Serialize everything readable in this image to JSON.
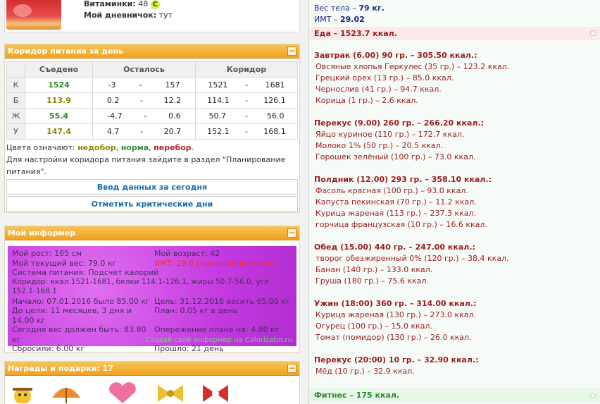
{
  "profile": {
    "vitamins_label": "Витаминки:",
    "vitamins_value": "48",
    "vitamins_badge": "C",
    "diary_label": "Мой дневничок:",
    "diary_value": "тут"
  },
  "corridor": {
    "title": "Коридор питания за день",
    "collapse_glyph": "−",
    "headers": [
      "Съедено",
      "Осталось",
      "Коридор"
    ],
    "dash": "-",
    "rows": [
      {
        "letter": "К",
        "eaten": "1524",
        "rem_min": "-3",
        "rem_max": "157",
        "c_min": "1521",
        "c_max": "1681"
      },
      {
        "letter": "Б",
        "eaten": "113.9",
        "rem_min": "0.2",
        "rem_max": "12.2",
        "c_min": "114.1",
        "c_max": "126.1"
      },
      {
        "letter": "Ж",
        "eaten": "55.4",
        "rem_min": "-4.7",
        "rem_max": "0.6",
        "c_min": "50.7",
        "c_max": "56.0"
      },
      {
        "letter": "У",
        "eaten": "147.4",
        "rem_min": "4.7",
        "rem_max": "20.7",
        "c_min": "152.1",
        "c_max": "168.1"
      }
    ],
    "legend_prefix": "Цвета означают:",
    "legend_under": "недобор",
    "legend_norm": "норма",
    "legend_over": "перебор",
    "legend_end": ".",
    "settings_text": "Для настройки коридора питания зайдите в раздел \"Планирование питания\".",
    "btn_input": "Ввод данных за сегодня",
    "btn_critical": "Отметить критические дни",
    "colors": {
      "under": "#8a8a00",
      "norm": "#2e8b2e",
      "over": "#b22222"
    }
  },
  "informer": {
    "title": "Мой информер",
    "collapse_glyph": "−",
    "rows": [
      [
        "Мой рост: 165 см",
        "Мой возраст: 42"
      ],
      [
        "Мой текущий вес: 79.0 кг",
        "ИМТ: 29.0 (превышение веса)"
      ],
      [
        "Система питания: Подсчет калорий",
        ""
      ],
      [
        "Коридор: ккал 1521-1681, белки 114.1-126.1, жиры 50.7-56.0, угл 152.1-168.1",
        ""
      ],
      [
        "Начало: 07.01.2016 было 85.00 кг",
        "Цель: 31.12.2016 весить 65.00 кг"
      ],
      [
        "До цели: 11 месяцев, 3 дня и 14.00 кг",
        "План: 0.05 кг в день"
      ],
      [
        "Сегодня вес должен быть: 83.80 кг",
        "Опережение плана на: 4.80 кг"
      ],
      [
        "Сбросили: 6.00 кг",
        "Прошло: 21 день"
      ]
    ],
    "link": "Создай свой информер на Calorizator.ru"
  },
  "gifts": {
    "title": "Награды и подарки: 17",
    "collapse_glyph": "−"
  },
  "diary": {
    "weight_label": "Вес тела",
    "weight_value": "79 кг.",
    "bmi_label": "ИМТ",
    "bmi_value": "29.02",
    "food_total": "Еда – 1523.7 ккал.",
    "meals": [
      {
        "title": "Завтрак (6.00) 90 гр. – 305.50 ккал.:",
        "items": [
          "Овсяные хлопья Геркулес (35 гр.) – 123.2 ккал.",
          "Грецкий орех (13 гр.) – 85.0 ккал.",
          "Чернослив (41 гр.) – 94.7 ккал.",
          "Корица (1 гр.) – 2.6 ккал."
        ]
      },
      {
        "title": "Перекус (9.00) 260 гр. – 266.20 ккал.:",
        "items": [
          "Яйцо куриное (110 гр.) – 172.7 ккал.",
          "Молоко 1% (50 гр.) – 20.5 ккал.",
          "Горошек зелёный (100 гр.) – 73.0 ккал."
        ]
      },
      {
        "title": "Полдник (12.00) 293 гр. – 358.10 ккал.:",
        "items": [
          "Фасоль красная (100 гр.) – 93.0 ккал.",
          "Капуста пекинская (70 гр.) – 11.2 ккал.",
          "Курица жареная (113 гр.) – 237.3 ккал.",
          "горчица французская (10 гр.) – 16.6 ккал."
        ]
      },
      {
        "title": "Обед (15.00) 440 гр. – 247.00 ккал.:",
        "items": [
          "творог обезжиренный 0% (120 гр.) – 38.4 ккал.",
          "Банан (140 гр.) – 133.0 ккал.",
          "Груша (180 гр.) – 75.6 ккал."
        ]
      },
      {
        "title": "Ужин (18:00) 360 гр. – 314.00 ккал.:",
        "items": [
          "Курица жареная (130 гр.) – 273.0 ккал.",
          "Огурец (100 гр.) – 15.0 ккал.",
          "Томат (помидор) (130 гр.) – 26.0 ккал."
        ]
      },
      {
        "title": "Перекус (20:00) 10 гр. – 32.90 ккал.:",
        "items": [
          "Мёд (10 гр.) – 32.9 ккал."
        ]
      }
    ],
    "fitness": "Фитнес – 175 ккал."
  }
}
